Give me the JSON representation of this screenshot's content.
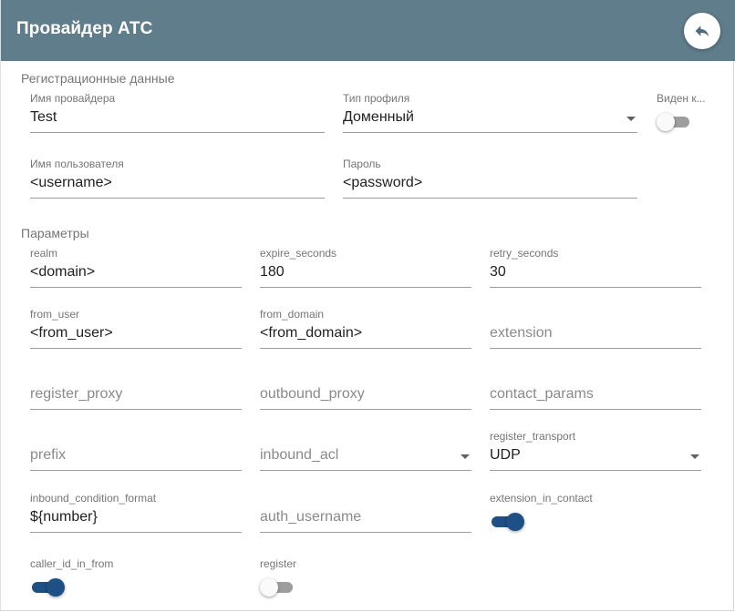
{
  "header": {
    "title": "Провайдер АТС",
    "back_icon": "reply-arrow-icon"
  },
  "colors": {
    "header_bg": "#607d8b",
    "toggle_on": "#1e4f85",
    "toggle_off": "#9e9e9e"
  },
  "registration": {
    "section_title": "Регистрационные данные",
    "provider_name": {
      "label": "Имя провайдера",
      "value": "Test"
    },
    "profile_type": {
      "label": "Тип профиля",
      "value": "Доменный"
    },
    "visible": {
      "label": "Виден к...",
      "state": "off"
    },
    "username": {
      "label": "Имя пользователя",
      "value": "<username>"
    },
    "password": {
      "label": "Пароль",
      "value": "<password>"
    }
  },
  "params": {
    "section_title": "Параметры",
    "realm": {
      "label": "realm",
      "value": "<domain>"
    },
    "expire_seconds": {
      "label": "expire_seconds",
      "value": "180"
    },
    "retry_seconds": {
      "label": "retry_seconds",
      "value": "30"
    },
    "from_user": {
      "label": "from_user",
      "value": "<from_user>"
    },
    "from_domain": {
      "label": "from_domain",
      "value": "<from_domain>"
    },
    "extension": {
      "placeholder": "extension"
    },
    "register_proxy": {
      "placeholder": "register_proxy"
    },
    "outbound_proxy": {
      "placeholder": "outbound_proxy"
    },
    "contact_params": {
      "placeholder": "contact_params"
    },
    "prefix": {
      "placeholder": "prefix"
    },
    "inbound_acl": {
      "placeholder": "inbound_acl"
    },
    "register_transport": {
      "label": "register_transport",
      "value": "UDP"
    },
    "inbound_condition_format": {
      "label": "inbound_condition_format",
      "value": "${number}"
    },
    "auth_username": {
      "placeholder": "auth_username"
    },
    "extension_in_contact": {
      "label": "extension_in_contact",
      "state": "on"
    },
    "caller_id_in_from": {
      "label": "caller_id_in_from",
      "state": "on"
    },
    "register": {
      "label": "register",
      "state": "off"
    }
  }
}
